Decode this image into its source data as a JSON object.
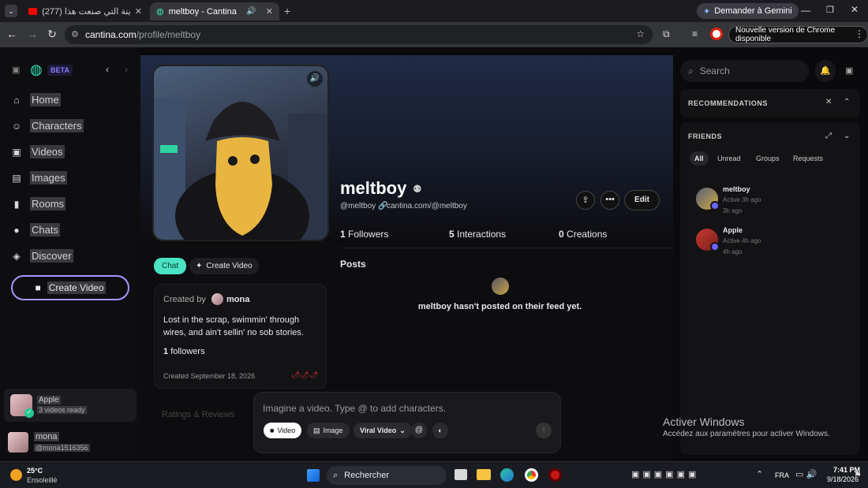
{
  "browser": {
    "tabs": [
      {
        "title": "(277) فبينا المدينة التي صنعت هذا",
        "active": false
      },
      {
        "title": "meltboy - Cantina",
        "active": true
      }
    ],
    "url_host": "cantina.com",
    "url_path": "/profile/meltboy",
    "gemini_label": "Demander à Gemini",
    "chrome_update_label": "Nouvelle version de Chrome disponible"
  },
  "sidebar": {
    "badge": "BETA",
    "items": [
      {
        "label": "Home",
        "icon": "home-icon"
      },
      {
        "label": "Characters",
        "icon": "robot-icon"
      },
      {
        "label": "Videos",
        "icon": "video-icon"
      },
      {
        "label": "Images",
        "icon": "image-icon"
      },
      {
        "label": "Rooms",
        "icon": "audio-icon"
      },
      {
        "label": "Chats",
        "icon": "chat-icon"
      },
      {
        "label": "Discover",
        "icon": "compass-icon"
      }
    ],
    "create_video": "Create Video",
    "notification": {
      "name": "Apple",
      "sub": "3 videos ready"
    },
    "user": {
      "name": "mona",
      "handle": "@mona1516356"
    }
  },
  "profile": {
    "name": "meltboy",
    "handle": "@meltboy",
    "link": "cantina.com/@meltboy",
    "edit_label": "Edit",
    "stats": [
      {
        "value": "1",
        "label": "Followers"
      },
      {
        "value": "5",
        "label": "Interactions"
      },
      {
        "value": "0",
        "label": "Creations"
      }
    ],
    "chat_label": "Chat",
    "create_video_label": "Create Video",
    "created_by_prefix": "Created by",
    "creator": "mona",
    "bio": "Lost in the scrap, swimmin' through wires, and ain't sellin' no sob stories.",
    "followers_count": "1",
    "followers_label": "followers",
    "created_date": "Created September 18, 2026",
    "ratings_label": "Ratings & Reviews"
  },
  "posts": {
    "title": "Posts",
    "empty": "meltboy hasn't posted on their feed yet."
  },
  "composer": {
    "placeholder": "Imagine a video. Type @ to add characters.",
    "video_label": "Video",
    "image_label": "Image",
    "model_label": "Viral Video"
  },
  "right": {
    "search_placeholder": "Search",
    "recommendations": "RECOMMENDATIONS",
    "friends": "FRIENDS",
    "filters": [
      "All",
      "Unread",
      "Groups",
      "Requests"
    ],
    "friend_list": [
      {
        "name": "meltboy",
        "status": "Active 3h ago",
        "time": "3h ago"
      },
      {
        "name": "Apple",
        "status": "Active 4h ago",
        "time": "4h ago"
      }
    ]
  },
  "windows": {
    "activate_title": "Activer Windows",
    "activate_sub": "Accédez aux paramètres pour activer Windows.",
    "weather_temp": "25°C",
    "weather_desc": "Ensoleillé",
    "search": "Rechercher",
    "lang": "FRA",
    "time": "7:41 PM",
    "date": "9/18/2026"
  }
}
